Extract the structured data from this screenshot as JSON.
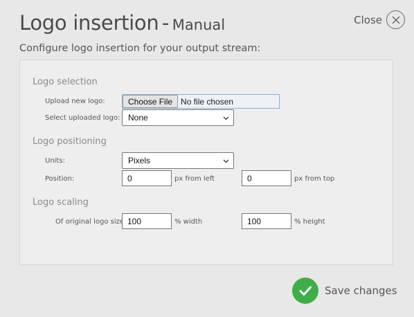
{
  "header": {
    "title": "Logo insertion",
    "separator": "-",
    "mode": "Manual",
    "close_label": "Close",
    "subtitle": "Configure logo insertion for your output stream:"
  },
  "sections": {
    "selection": {
      "title": "Logo selection",
      "upload_label": "Upload new logo:",
      "choose_file_button": "Choose File",
      "file_status": "No file chosen",
      "select_label": "Select uploaded logo:",
      "selected_logo": "None"
    },
    "positioning": {
      "title": "Logo positioning",
      "units_label": "Units:",
      "units_value": "Pixels",
      "position_label": "Position:",
      "x_value": "0",
      "x_unit": "px from left",
      "y_value": "0",
      "y_unit": "px from top"
    },
    "scaling": {
      "title": "Logo scaling",
      "size_label": "Of original logo size:",
      "width_value": "100",
      "width_unit": "% width",
      "height_value": "100",
      "height_unit": "% height"
    }
  },
  "footer": {
    "save_label": "Save changes"
  },
  "colors": {
    "background": "#e8e8e8",
    "panel": "#eeeeee",
    "save_green": "#3fae49"
  }
}
